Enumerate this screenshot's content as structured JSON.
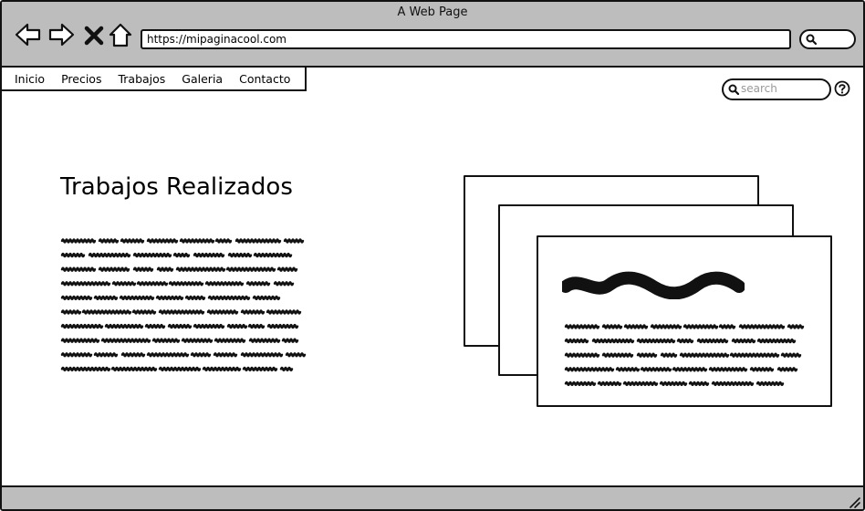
{
  "window": {
    "title": "A Web Page"
  },
  "browser": {
    "url": "https://mipaginacool.com",
    "icons": [
      "back-arrow-icon",
      "forward-arrow-icon",
      "close-x-icon",
      "home-icon",
      "search-icon"
    ]
  },
  "menu": {
    "items": [
      {
        "label": "Inicio"
      },
      {
        "label": "Precios"
      },
      {
        "label": "Trabajos"
      },
      {
        "label": "Galeria"
      },
      {
        "label": "Contacto"
      }
    ]
  },
  "search": {
    "placeholder": "search"
  },
  "main": {
    "title": "Trabajos Realizados",
    "paragraph_lines": 10,
    "card_paragraph_lines": 5
  },
  "colors": {
    "chrome": "#bdbdbd",
    "stroke": "#111111",
    "placeholder": "#999999"
  }
}
